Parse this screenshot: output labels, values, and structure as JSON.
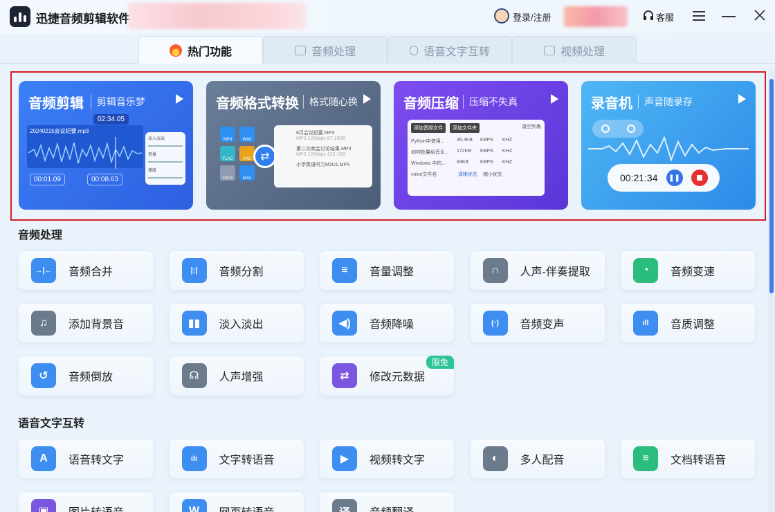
{
  "app": {
    "title": "迅捷音频剪辑软件",
    "login": "登录/注册",
    "service": "客服"
  },
  "tabs": [
    {
      "label": "热门功能",
      "active": true,
      "icon": "fire-icon"
    },
    {
      "label": "音频处理",
      "active": false,
      "icon": "music-file-icon"
    },
    {
      "label": "语音文字互转",
      "active": false,
      "icon": "mic-file-icon"
    },
    {
      "label": "视频处理",
      "active": false,
      "icon": "video-camera-icon"
    }
  ],
  "features": [
    {
      "title": "音频剪辑",
      "sub": "剪辑音乐梦",
      "file": "20240215会议纪要.mp3",
      "marker": "02:34.05",
      "t1": "00:01.09",
      "t2": "00:08.63",
      "opts": [
        "淡入淡出",
        "音量",
        "速度"
      ]
    },
    {
      "title": "音频格式转换",
      "sub": "格式随心换",
      "formats": [
        "MP3",
        "WAV",
        "FLAC",
        "AAC",
        "OGG",
        "M4A"
      ],
      "files": [
        {
          "name": "8月会议纪要.MP3",
          "meta": "MP3    128kbps    87.19KB"
        },
        {
          "name": "第二次商会讨论结果.MP3",
          "meta": "MP3    128kbps    125.1KB"
        },
        {
          "name": "小学英语听力M3U1.MP3",
          "meta": ""
        }
      ]
    },
    {
      "title": "音频压缩",
      "sub": "压缩不失真",
      "buttons": [
        "添加音频文件",
        "添加文件夹",
        "清空列表"
      ],
      "rows": [
        [
          "Python中使用...",
          "36.4KB",
          "KBPS",
          "KHZ"
        ],
        [
          "如何批量给音乐...",
          "172KB",
          "KBPS",
          "KHZ"
        ],
        [
          "Windows 中的...",
          "84KB",
          "KBPS",
          "KHZ"
        ],
        [
          "voice文件名",
          "",
          "",
          ""
        ]
      ],
      "option_a": "清晰优先",
      "option_b": "缩小优先"
    },
    {
      "title": "录音机",
      "sub": "声音随录存",
      "time": "00:21:34"
    }
  ],
  "sections": {
    "audio": {
      "title": "音频处理",
      "items": [
        {
          "label": "音频合并",
          "icon": "merge-icon",
          "color": "#3d8ef0"
        },
        {
          "label": "音频分割",
          "icon": "split-icon",
          "color": "#3d8ef0"
        },
        {
          "label": "音量调整",
          "icon": "volume-sliders-icon",
          "color": "#3d8ef0"
        },
        {
          "label": "人声-伴奏提取",
          "icon": "headphone-icon",
          "color": "#6b7b8c"
        },
        {
          "label": "音频变速",
          "icon": "speed-icon",
          "color": "#2bbd7e"
        },
        {
          "label": "添加背景音",
          "icon": "music-note-icon",
          "color": "#6b7b8c"
        },
        {
          "label": "淡入淡出",
          "icon": "bars-icon",
          "color": "#3d8ef0"
        },
        {
          "label": "音频降噪",
          "icon": "speaker-icon",
          "color": "#3d8ef0"
        },
        {
          "label": "音频变声",
          "icon": "voice-change-icon",
          "color": "#3d8ef0"
        },
        {
          "label": "音质调整",
          "icon": "quality-icon",
          "color": "#3d8ef0"
        },
        {
          "label": "音频倒放",
          "icon": "reverse-icon",
          "color": "#3d8ef0"
        },
        {
          "label": "人声增强",
          "icon": "voice-enhance-icon",
          "color": "#6b7b8c"
        },
        {
          "label": "修改元数据",
          "icon": "metadata-icon",
          "color": "#7b56e0",
          "badge": "限免"
        }
      ]
    },
    "speech": {
      "title": "语音文字互转",
      "items": [
        {
          "label": "语音转文字",
          "icon": "letter-a-icon",
          "color": "#3d8ef0"
        },
        {
          "label": "文字转语音",
          "icon": "waveform-icon",
          "color": "#3d8ef0"
        },
        {
          "label": "视频转文字",
          "icon": "play-circle-icon",
          "color": "#3d8ef0"
        },
        {
          "label": "多人配音",
          "icon": "mic-icon",
          "color": "#6b7b8c"
        },
        {
          "label": "文档转语音",
          "icon": "document-icon",
          "color": "#2bbd7e"
        },
        {
          "label": "图片转语音",
          "icon": "image-icon",
          "color": "#7b56e0"
        },
        {
          "label": "网页转语音",
          "icon": "web-icon",
          "color": "#3d8ef0"
        },
        {
          "label": "音频翻译",
          "icon": "translate-icon",
          "color": "#6b7b8c"
        }
      ]
    }
  }
}
